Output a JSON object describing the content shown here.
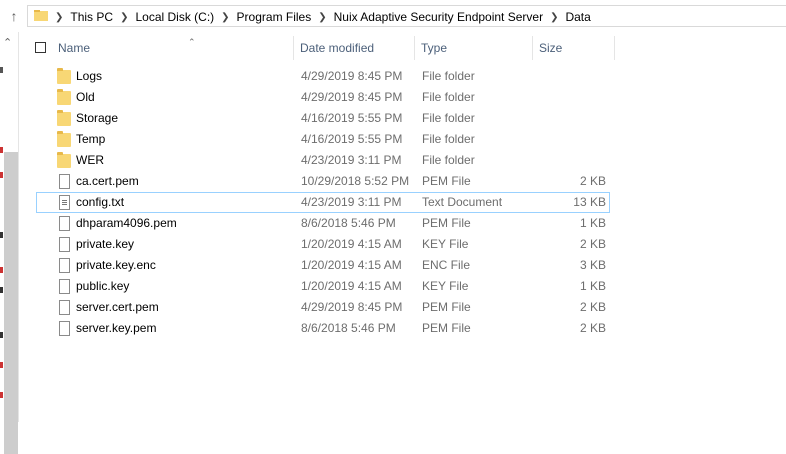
{
  "addressbar": {
    "crumbs": [
      "This PC",
      "Local Disk (C:)",
      "Program Files",
      "Nuix Adaptive Security Endpoint Server",
      "Data"
    ]
  },
  "columns": {
    "name": "Name",
    "date": "Date modified",
    "type": "Type",
    "size": "Size"
  },
  "files": [
    {
      "name": "Logs",
      "date": "4/29/2019 8:45 PM",
      "type": "File folder",
      "size": "",
      "icon": "folder-icon"
    },
    {
      "name": "Old",
      "date": "4/29/2019 8:45 PM",
      "type": "File folder",
      "size": "",
      "icon": "folder-icon"
    },
    {
      "name": "Storage",
      "date": "4/16/2019 5:55 PM",
      "type": "File folder",
      "size": "",
      "icon": "folder-icon"
    },
    {
      "name": "Temp",
      "date": "4/16/2019 5:55 PM",
      "type": "File folder",
      "size": "",
      "icon": "folder-icon"
    },
    {
      "name": "WER",
      "date": "4/23/2019 3:11 PM",
      "type": "File folder",
      "size": "",
      "icon": "folder-icon"
    },
    {
      "name": "ca.cert.pem",
      "date": "10/29/2018 5:52 PM",
      "type": "PEM File",
      "size": "2 KB",
      "icon": "file-icon"
    },
    {
      "name": "config.txt",
      "date": "4/23/2019 3:11 PM",
      "type": "Text Document",
      "size": "13 KB",
      "icon": "text-file-icon",
      "selected": true
    },
    {
      "name": "dhparam4096.pem",
      "date": "8/6/2018 5:46 PM",
      "type": "PEM File",
      "size": "1 KB",
      "icon": "file-icon"
    },
    {
      "name": "private.key",
      "date": "1/20/2019 4:15 AM",
      "type": "KEY File",
      "size": "2 KB",
      "icon": "file-icon"
    },
    {
      "name": "private.key.enc",
      "date": "1/20/2019 4:15 AM",
      "type": "ENC File",
      "size": "3 KB",
      "icon": "file-icon"
    },
    {
      "name": "public.key",
      "date": "1/20/2019 4:15 AM",
      "type": "KEY File",
      "size": "1 KB",
      "icon": "file-icon"
    },
    {
      "name": "server.cert.pem",
      "date": "4/29/2019 8:45 PM",
      "type": "PEM File",
      "size": "2 KB",
      "icon": "file-icon"
    },
    {
      "name": "server.key.pem",
      "date": "8/6/2018 5:46 PM",
      "type": "PEM File",
      "size": "2 KB",
      "icon": "file-icon"
    }
  ],
  "colors": {
    "header_text": "#4c607a",
    "selection_border": "#99d1ff",
    "folder": "#f8d775"
  }
}
